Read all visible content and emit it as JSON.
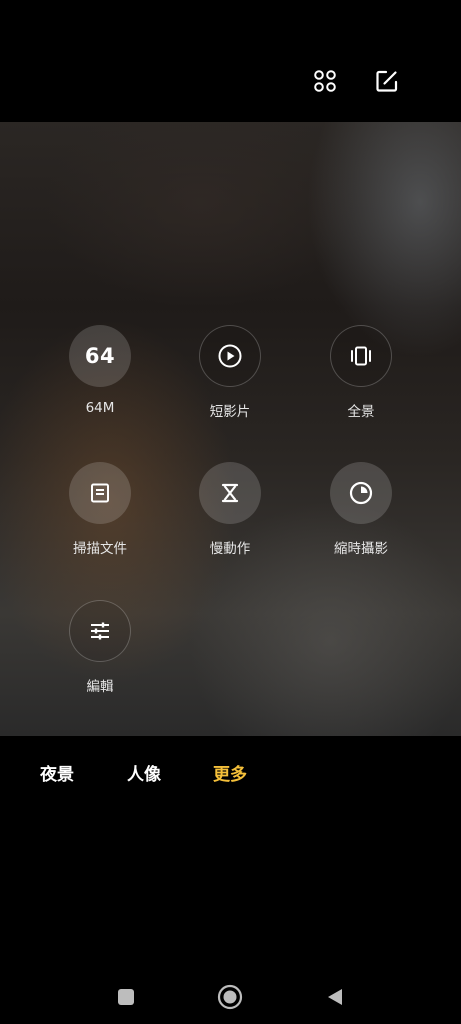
{
  "top_bar": {
    "icons": [
      "grid-icon",
      "edit-icon"
    ]
  },
  "modes": [
    {
      "key": "64m",
      "circle_text": "64",
      "label": "64M",
      "icon": "number-64",
      "style": "filled"
    },
    {
      "key": "short-video",
      "circle_text": "",
      "label": "短影片",
      "icon": "play-circle-icon",
      "style": "outlined"
    },
    {
      "key": "panorama",
      "circle_text": "",
      "label": "全景",
      "icon": "panorama-icon",
      "style": "outlined"
    },
    {
      "key": "scan-document",
      "circle_text": "",
      "label": "掃描文件",
      "icon": "document-icon",
      "style": "filled"
    },
    {
      "key": "slow-motion",
      "circle_text": "",
      "label": "慢動作",
      "icon": "hourglass-icon",
      "style": "filled"
    },
    {
      "key": "timelapse",
      "circle_text": "",
      "label": "縮時攝影",
      "icon": "timer-icon",
      "style": "filled"
    },
    {
      "key": "edit",
      "circle_text": "",
      "label": "編輯",
      "icon": "sliders-icon",
      "style": "outlined"
    }
  ],
  "mode_tabs": [
    {
      "label": "夜景",
      "active": false
    },
    {
      "label": "人像",
      "active": false
    },
    {
      "label": "更多",
      "active": true
    }
  ],
  "colors": {
    "active_tab": "#f5c03a",
    "background": "#000000"
  },
  "nav_bar": {
    "icons": [
      "recents-icon",
      "home-icon",
      "back-icon"
    ]
  }
}
